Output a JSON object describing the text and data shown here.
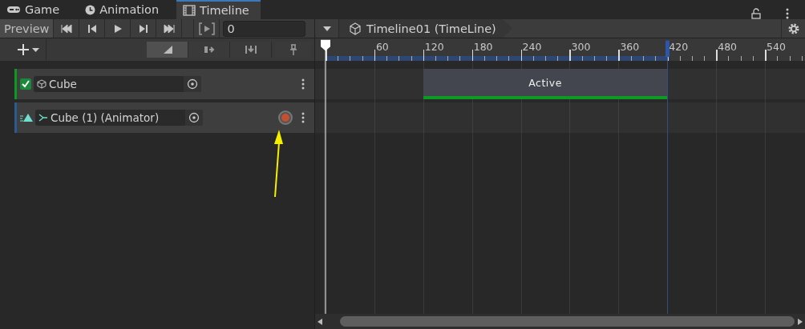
{
  "tabs": [
    {
      "label": "Game",
      "kind": "game",
      "selected": false
    },
    {
      "label": "Animation",
      "kind": "animation",
      "selected": false
    },
    {
      "label": "Timeline",
      "kind": "timeline",
      "selected": true
    }
  ],
  "toolbar": {
    "preview": {
      "label": "Preview",
      "on": false
    },
    "frame_field": {
      "value": "0"
    }
  },
  "breadcrumb": {
    "title": "Timeline01 (TimeLine)"
  },
  "mode_buttons": [
    {
      "kind": "mix",
      "selected": true
    },
    {
      "kind": "ripple",
      "selected": false
    },
    {
      "kind": "replace",
      "selected": false
    }
  ],
  "ruler": {
    "labels": [
      "60",
      "120",
      "180",
      "240",
      "300",
      "360",
      "420",
      "480",
      "540"
    ]
  },
  "tracks": [
    {
      "kind": "activation",
      "name": "Cube",
      "enabled": true,
      "color": "#0a9a22",
      "clip": {
        "label": "Active"
      }
    },
    {
      "kind": "animation",
      "name": "Cube (1) (Animator)",
      "color": "#2a5a92"
    }
  ]
}
